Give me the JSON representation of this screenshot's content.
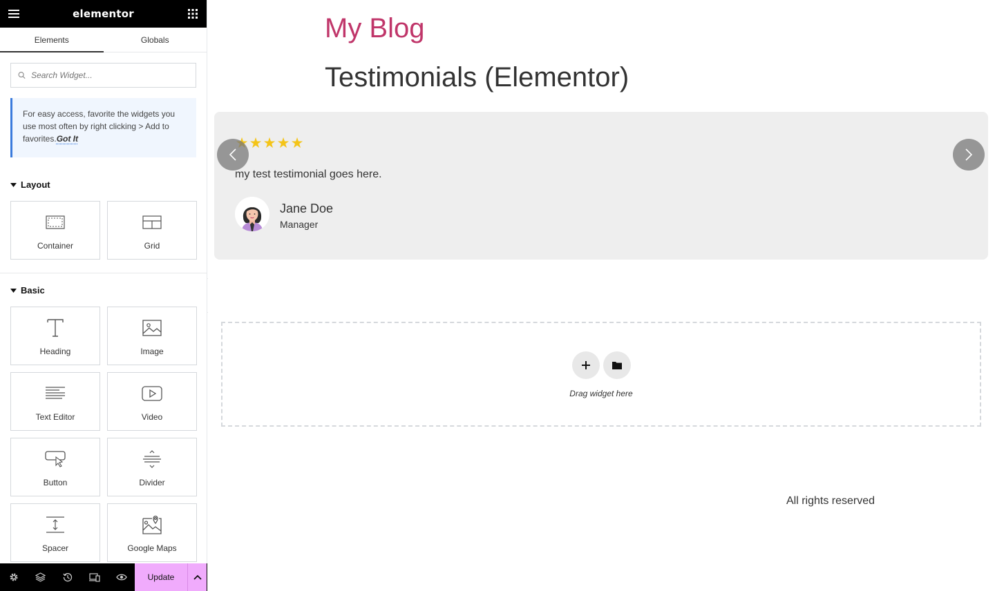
{
  "panel": {
    "logo": "elementor",
    "tabs": [
      {
        "label": "Elements"
      },
      {
        "label": "Globals"
      }
    ],
    "search": {
      "placeholder": "Search Widget..."
    },
    "tip": {
      "text": "For easy access, favorite the widgets you use most often by right clicking > Add to favorites.",
      "link": "Got It"
    },
    "categories": {
      "layout": {
        "title": "Layout",
        "widgets": [
          {
            "label": "Container",
            "icon": "container-icon"
          },
          {
            "label": "Grid",
            "icon": "grid-icon"
          }
        ]
      },
      "basic": {
        "title": "Basic",
        "widgets": [
          {
            "label": "Heading",
            "icon": "heading-icon"
          },
          {
            "label": "Image",
            "icon": "image-icon"
          },
          {
            "label": "Text Editor",
            "icon": "text-editor-icon"
          },
          {
            "label": "Video",
            "icon": "video-icon"
          },
          {
            "label": "Button",
            "icon": "button-icon"
          },
          {
            "label": "Divider",
            "icon": "divider-icon"
          },
          {
            "label": "Spacer",
            "icon": "spacer-icon"
          },
          {
            "label": "Google Maps",
            "icon": "google-maps-icon"
          }
        ]
      }
    },
    "footer": {
      "update_label": "Update"
    }
  },
  "preview": {
    "site_title": "My Blog",
    "page_heading": "Testimonials (Elementor)",
    "testimonial": {
      "rating": 5,
      "stars": "★★★★★",
      "text": "my test testimonial goes here.",
      "name": "Jane Doe",
      "role": "Manager"
    },
    "drop_zone": {
      "text": "Drag widget here"
    },
    "footer_text": "All rights reserved"
  },
  "colors": {
    "site_title": "#c0366a",
    "star": "#f4c418",
    "update_button": "#f0abfc",
    "tip_border": "#3b7bdc"
  }
}
